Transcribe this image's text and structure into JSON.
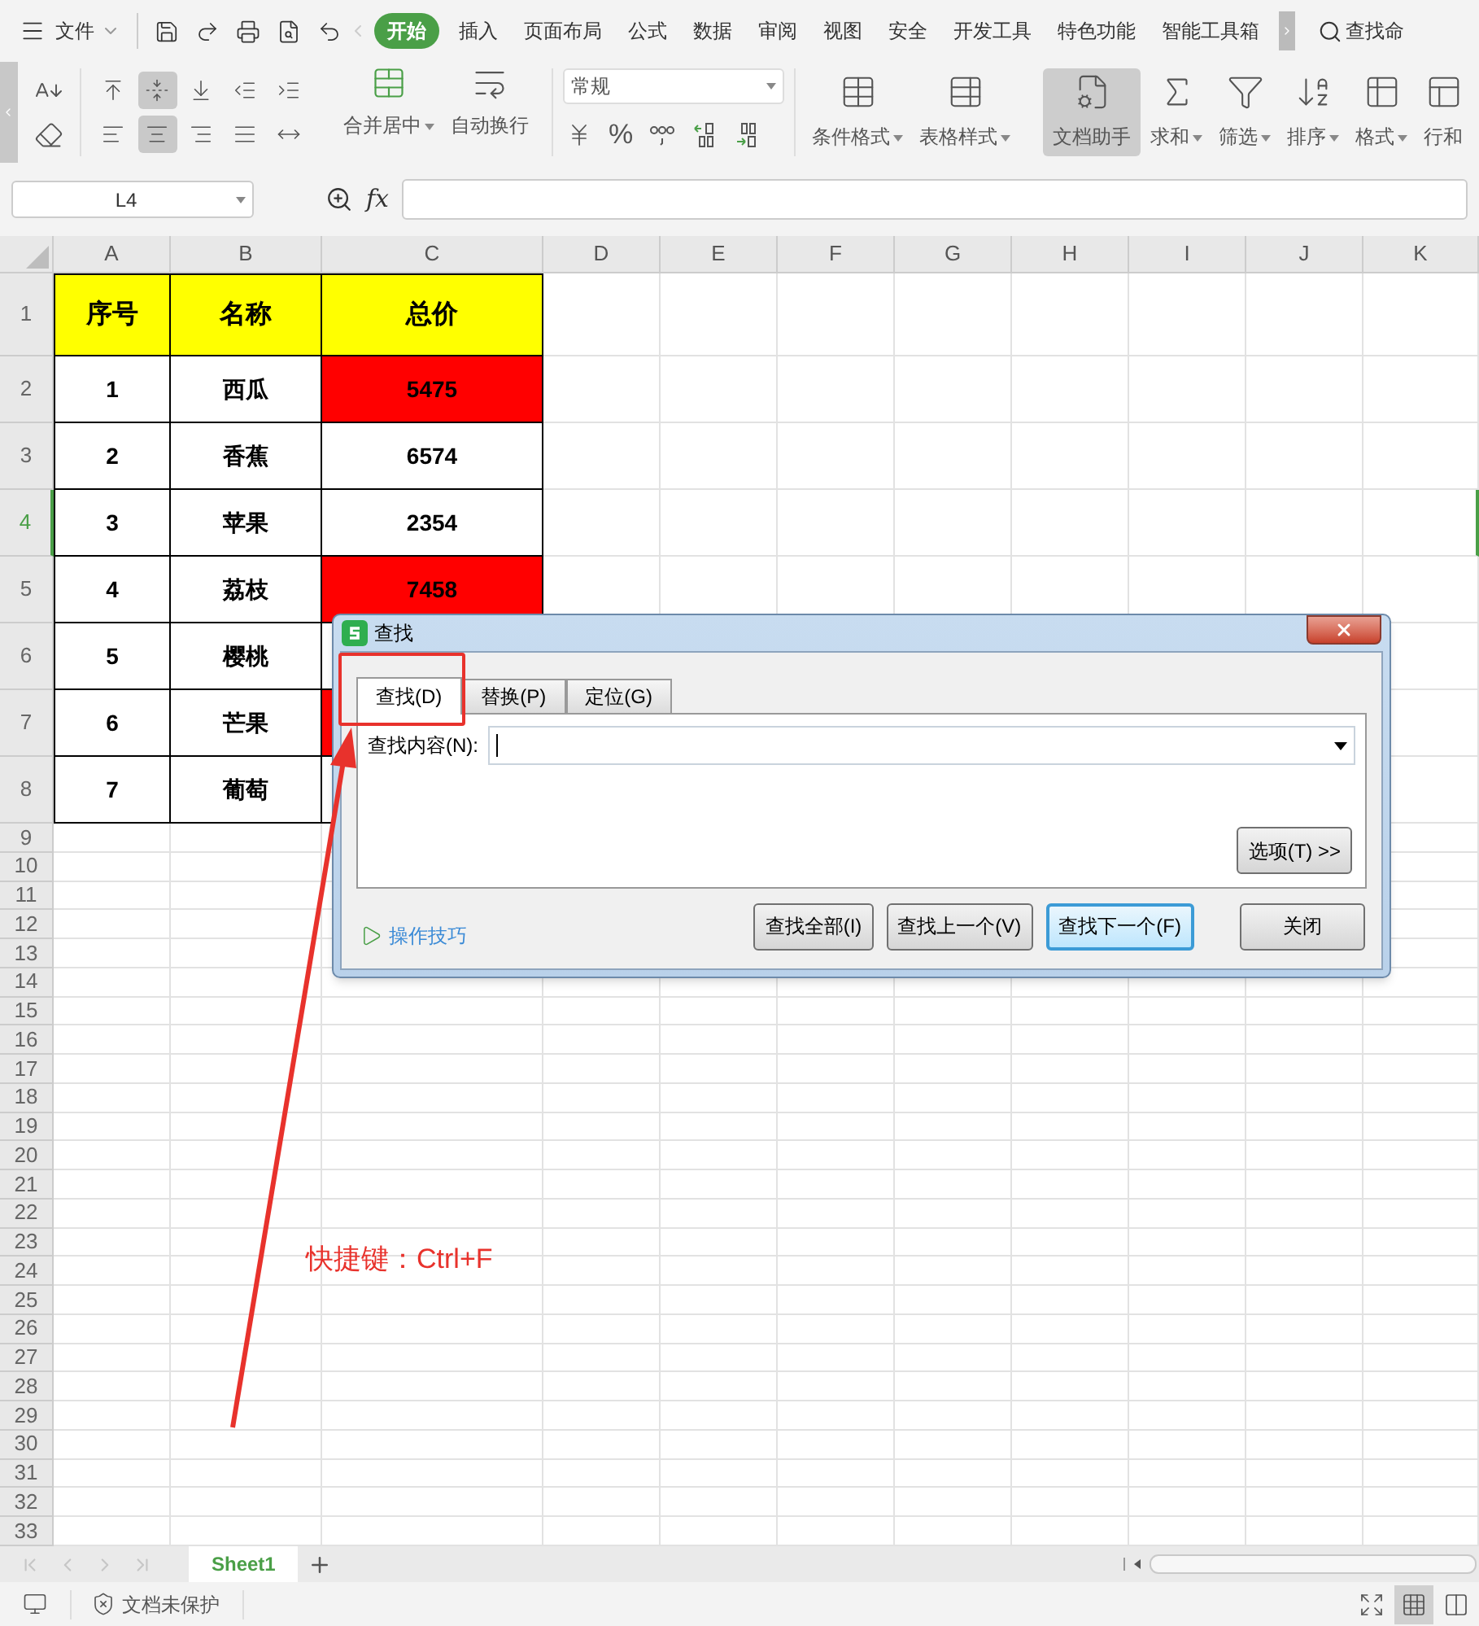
{
  "menu_bar": {
    "file_label": "文件",
    "tabs": [
      {
        "label": "开始",
        "selected": true
      },
      {
        "label": "插入",
        "selected": false
      },
      {
        "label": "页面布局",
        "selected": false
      },
      {
        "label": "公式",
        "selected": false
      },
      {
        "label": "数据",
        "selected": false
      },
      {
        "label": "审阅",
        "selected": false
      },
      {
        "label": "视图",
        "selected": false
      },
      {
        "label": "安全",
        "selected": false
      },
      {
        "label": "开发工具",
        "selected": false
      },
      {
        "label": "特色功能",
        "selected": false
      },
      {
        "label": "智能工具箱",
        "selected": false
      }
    ],
    "search_label": "查找命"
  },
  "ribbon": {
    "align_buttons": [
      {
        "kind": "top",
        "selected": false
      },
      {
        "kind": "middle",
        "selected": true
      },
      {
        "kind": "bottom",
        "selected": false
      },
      {
        "kind": "outdent",
        "selected": false
      },
      {
        "kind": "indent",
        "selected": false
      },
      {
        "kind": "left",
        "selected": false
      },
      {
        "kind": "center",
        "selected": true
      },
      {
        "kind": "right",
        "selected": false
      },
      {
        "kind": "justify",
        "selected": false
      },
      {
        "kind": "distributed",
        "selected": false
      }
    ],
    "merge_label": "合并居中",
    "wrap_label": "自动换行",
    "number_format": "常规",
    "percent": "%",
    "tools": [
      {
        "kind": "conditional",
        "label": "条件格式",
        "dropdown": true,
        "selected": false
      },
      {
        "kind": "table_style",
        "label": "表格样式",
        "dropdown": true,
        "selected": false
      },
      {
        "kind": "doc_helper",
        "label": "文档助手",
        "dropdown": false,
        "selected": true
      },
      {
        "kind": "sum",
        "label": "求和",
        "dropdown": true,
        "selected": false
      },
      {
        "kind": "filter",
        "label": "筛选",
        "dropdown": true,
        "selected": false
      },
      {
        "kind": "sort",
        "label": "排序",
        "dropdown": true,
        "selected": false
      },
      {
        "kind": "format",
        "label": "格式",
        "dropdown": true,
        "selected": false
      },
      {
        "kind": "rows_cols",
        "label": "行和",
        "dropdown": false,
        "selected": false
      }
    ]
  },
  "formula_bar": {
    "name_box": "L4",
    "fx": "fx"
  },
  "grid": {
    "columns": [
      "A",
      "B",
      "C",
      "D",
      "E",
      "F",
      "G",
      "H",
      "I",
      "J",
      "K"
    ],
    "rows": [
      {
        "header": "1",
        "kind": "title",
        "selected": false,
        "cells": [
          {
            "text": "序号"
          },
          {
            "text": "名称"
          },
          {
            "text": "总价"
          }
        ]
      },
      {
        "header": "2",
        "kind": "data",
        "selected": false,
        "cells": [
          {
            "text": "1"
          },
          {
            "text": "西瓜"
          },
          {
            "text": "5475",
            "highlighted": true
          }
        ]
      },
      {
        "header": "3",
        "kind": "data",
        "selected": false,
        "cells": [
          {
            "text": "2"
          },
          {
            "text": "香蕉"
          },
          {
            "text": "6574",
            "highlighted": false
          }
        ]
      },
      {
        "header": "4",
        "kind": "data",
        "selected": true,
        "cells": [
          {
            "text": "3"
          },
          {
            "text": "苹果"
          },
          {
            "text": "2354",
            "highlighted": false
          }
        ]
      },
      {
        "header": "5",
        "kind": "data",
        "selected": false,
        "cells": [
          {
            "text": "4"
          },
          {
            "text": "荔枝"
          },
          {
            "text": "7458",
            "highlighted": true
          }
        ]
      },
      {
        "header": "6",
        "kind": "data",
        "selected": false,
        "cells": [
          {
            "text": "5"
          },
          {
            "text": "樱桃"
          },
          {
            "highlighted": false
          }
        ]
      },
      {
        "header": "7",
        "kind": "data",
        "selected": false,
        "cells": [
          {
            "text": "6"
          },
          {
            "text": "芒果"
          },
          {
            "highlighted": true
          }
        ]
      },
      {
        "header": "8",
        "kind": "data",
        "selected": false,
        "cells": [
          {
            "text": "7"
          },
          {
            "text": "葡萄"
          },
          {
            "highlighted": false
          }
        ]
      },
      {
        "header": "9",
        "kind": "empty",
        "selected": false
      },
      {
        "header": "10",
        "kind": "empty",
        "selected": false
      },
      {
        "header": "11",
        "kind": "empty",
        "selected": false
      },
      {
        "header": "12",
        "kind": "empty",
        "selected": false
      },
      {
        "header": "13",
        "kind": "empty",
        "selected": false
      },
      {
        "header": "14",
        "kind": "empty",
        "selected": false
      },
      {
        "header": "15",
        "kind": "empty",
        "selected": false
      },
      {
        "header": "16",
        "kind": "empty",
        "selected": false
      },
      {
        "header": "17",
        "kind": "empty",
        "selected": false
      },
      {
        "header": "18",
        "kind": "empty",
        "selected": false
      },
      {
        "header": "19",
        "kind": "empty",
        "selected": false
      },
      {
        "header": "20",
        "kind": "empty",
        "selected": false
      },
      {
        "header": "21",
        "kind": "empty",
        "selected": false
      },
      {
        "header": "22",
        "kind": "empty",
        "selected": false
      },
      {
        "header": "23",
        "kind": "empty",
        "selected": false
      },
      {
        "header": "24",
        "kind": "empty",
        "selected": false
      },
      {
        "header": "25",
        "kind": "empty",
        "selected": false
      },
      {
        "header": "26",
        "kind": "empty",
        "selected": false
      },
      {
        "header": "27",
        "kind": "empty",
        "selected": false
      },
      {
        "header": "28",
        "kind": "empty",
        "selected": false
      },
      {
        "header": "29",
        "kind": "empty",
        "selected": false
      },
      {
        "header": "30",
        "kind": "empty",
        "selected": false
      },
      {
        "header": "31",
        "kind": "empty",
        "selected": false
      },
      {
        "header": "32",
        "kind": "empty",
        "selected": false
      },
      {
        "header": "33",
        "kind": "empty",
        "selected": false
      }
    ]
  },
  "dialog": {
    "title": "查找",
    "tabs": [
      {
        "label": "查找(D)",
        "selected": true
      },
      {
        "label": "替换(P)",
        "selected": false
      },
      {
        "label": "定位(G)",
        "selected": false
      }
    ],
    "field_label": "查找内容(N):",
    "options_button": "选项(T) >>",
    "tips_link": "操作技巧",
    "action_buttons": [
      {
        "label": "查找全部(I)",
        "default": false
      },
      {
        "label": "查找上一个(V)",
        "default": false
      },
      {
        "label": "查找下一个(F)",
        "default": true
      }
    ],
    "close_button": "关闭"
  },
  "annotation": {
    "text": "快捷键：Ctrl+F"
  },
  "sheet_tabs": [
    {
      "label": "Sheet1",
      "selected": true
    }
  ],
  "status_bar": {
    "protection": "文档未保护",
    "view_buttons": [
      {
        "kind": "fullscreen",
        "selected": false
      },
      {
        "kind": "normal",
        "selected": true
      },
      {
        "kind": "page_break",
        "selected": false
      }
    ]
  }
}
